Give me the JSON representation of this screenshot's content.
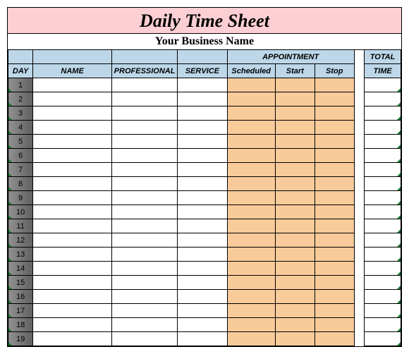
{
  "title": "Daily Time Sheet",
  "subtitle": "Your Business Name",
  "headers": {
    "appointment": "APPOINTMENT",
    "total": "TOTAL",
    "day": "DAY",
    "name": "NAME",
    "professional": "PROFESSIONAL",
    "service": "SERVICE",
    "scheduled": "Scheduled",
    "start": "Start",
    "stop": "Stop",
    "time": "TIME"
  },
  "rows": [
    {
      "day": "1",
      "name": "",
      "professional": "",
      "service": "",
      "scheduled": "",
      "start": "",
      "stop": "",
      "total": ""
    },
    {
      "day": "2",
      "name": "",
      "professional": "",
      "service": "",
      "scheduled": "",
      "start": "",
      "stop": "",
      "total": ""
    },
    {
      "day": "3",
      "name": "",
      "professional": "",
      "service": "",
      "scheduled": "",
      "start": "",
      "stop": "",
      "total": ""
    },
    {
      "day": "4",
      "name": "",
      "professional": "",
      "service": "",
      "scheduled": "",
      "start": "",
      "stop": "",
      "total": ""
    },
    {
      "day": "5",
      "name": "",
      "professional": "",
      "service": "",
      "scheduled": "",
      "start": "",
      "stop": "",
      "total": ""
    },
    {
      "day": "6",
      "name": "",
      "professional": "",
      "service": "",
      "scheduled": "",
      "start": "",
      "stop": "",
      "total": ""
    },
    {
      "day": "7",
      "name": "",
      "professional": "",
      "service": "",
      "scheduled": "",
      "start": "",
      "stop": "",
      "total": ""
    },
    {
      "day": "8",
      "name": "",
      "professional": "",
      "service": "",
      "scheduled": "",
      "start": "",
      "stop": "",
      "total": ""
    },
    {
      "day": "9",
      "name": "",
      "professional": "",
      "service": "",
      "scheduled": "",
      "start": "",
      "stop": "",
      "total": ""
    },
    {
      "day": "10",
      "name": "",
      "professional": "",
      "service": "",
      "scheduled": "",
      "start": "",
      "stop": "",
      "total": ""
    },
    {
      "day": "11",
      "name": "",
      "professional": "",
      "service": "",
      "scheduled": "",
      "start": "",
      "stop": "",
      "total": ""
    },
    {
      "day": "12",
      "name": "",
      "professional": "",
      "service": "",
      "scheduled": "",
      "start": "",
      "stop": "",
      "total": ""
    },
    {
      "day": "13",
      "name": "",
      "professional": "",
      "service": "",
      "scheduled": "",
      "start": "",
      "stop": "",
      "total": ""
    },
    {
      "day": "14",
      "name": "",
      "professional": "",
      "service": "",
      "scheduled": "",
      "start": "",
      "stop": "",
      "total": ""
    },
    {
      "day": "15",
      "name": "",
      "professional": "",
      "service": "",
      "scheduled": "",
      "start": "",
      "stop": "",
      "total": ""
    },
    {
      "day": "16",
      "name": "",
      "professional": "",
      "service": "",
      "scheduled": "",
      "start": "",
      "stop": "",
      "total": ""
    },
    {
      "day": "17",
      "name": "",
      "professional": "",
      "service": "",
      "scheduled": "",
      "start": "",
      "stop": "",
      "total": ""
    },
    {
      "day": "18",
      "name": "",
      "professional": "",
      "service": "",
      "scheduled": "",
      "start": "",
      "stop": "",
      "total": ""
    },
    {
      "day": "19",
      "name": "",
      "professional": "",
      "service": "",
      "scheduled": "",
      "start": "",
      "stop": "",
      "total": ""
    }
  ]
}
